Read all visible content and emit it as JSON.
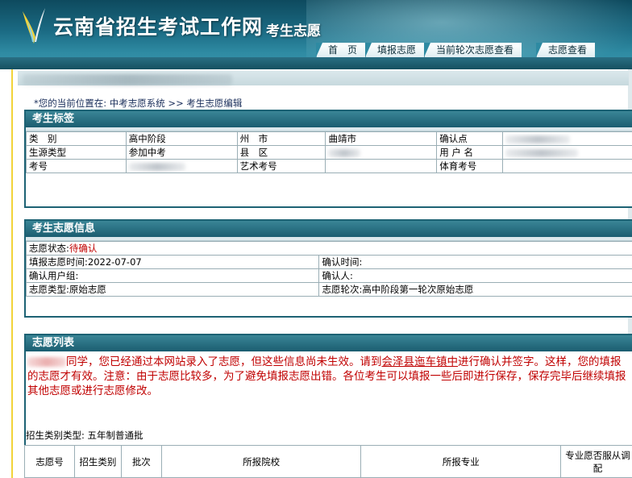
{
  "header": {
    "site_title": "云南省招生考试工作网",
    "site_sub": "考生志愿",
    "nav": [
      "首　页",
      "填报志愿",
      "当前轮次志愿查看",
      "志愿查看"
    ]
  },
  "breadcrumb": "*您的当前位置在: 中考志愿系统 >> 考生志愿编辑",
  "student_tag": {
    "title": "考生标签",
    "rows": [
      [
        "类　别",
        "高中阶段",
        "州　市",
        "曲靖市",
        "确认点",
        ""
      ],
      [
        "生源类型",
        "参加中考",
        "县　区",
        "",
        "用 户 名",
        ""
      ],
      [
        "考号",
        "",
        "艺术考号",
        "",
        "体育考号",
        ""
      ]
    ]
  },
  "application_info": {
    "title": "考生志愿信息",
    "status_label": "志愿状态:",
    "status_value": "待确认",
    "fill_time": "填报志愿时间:2022-07-07",
    "confirm_time": "确认时间:",
    "confirm_user_group": "确认用户组:",
    "confirmer": "确认人:",
    "app_type": "志愿类型:原始志愿",
    "app_round": "志愿轮次:高中阶段第一轮次原始志愿"
  },
  "application_list": {
    "title": "志愿列表",
    "notice_part1": "同学，您已经通过本网站录入了志愿，但这些信息尚未生效。请到",
    "notice_link": "会泽县迤车镇中",
    "notice_part2": "进行确认并签字。这样，您的填报的志愿才有效。注意：由于志愿比较多，为了避免填报志愿出错。各位考生可以填报一些后即进行保存，保存完毕后继续填报其他志愿或进行志愿修改。",
    "category_type": "招生类别类型: 五年制普通批",
    "columns": [
      "志愿号",
      "招生类别",
      "批次",
      "所报院校",
      "所报专业",
      "专业愿否服从调配"
    ]
  },
  "colors": {
    "header": "#1b6b84",
    "panel": "#1d6274",
    "alert": "#c00000",
    "accent_line": "#f2d33a"
  }
}
